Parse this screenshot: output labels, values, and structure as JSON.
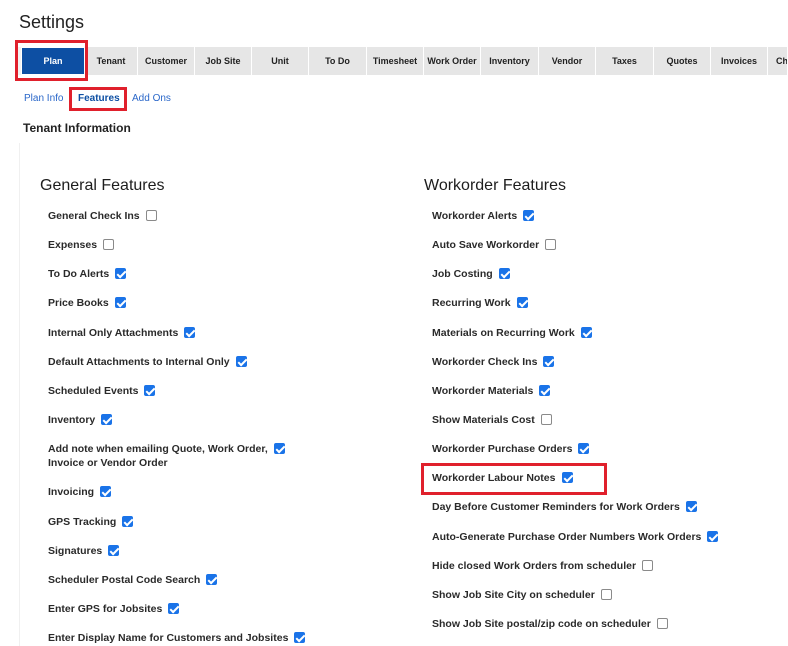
{
  "page": {
    "title": "Settings"
  },
  "tabs": [
    "Plan",
    "Tenant",
    "Customer",
    "Job Site",
    "Unit",
    "To Do",
    "Timesheet",
    "Work Order",
    "Inventory",
    "Vendor",
    "Taxes",
    "Quotes",
    "Invoices",
    "Ch"
  ],
  "active_tab": "Plan",
  "sublinks": [
    "Plan Info",
    "Features",
    "Add Ons"
  ],
  "active_sublink": "Features",
  "section_title": "Tenant Information",
  "general": {
    "title": "General Features",
    "items": [
      {
        "label": "General Check Ins",
        "checked": false
      },
      {
        "label": "Expenses",
        "checked": false
      },
      {
        "label": "To Do Alerts",
        "checked": true
      },
      {
        "label": "Price Books",
        "checked": true
      },
      {
        "label": "Internal Only Attachments",
        "checked": true
      },
      {
        "label": "Default Attachments to Internal Only",
        "checked": true
      },
      {
        "label": "Scheduled Events",
        "checked": true
      },
      {
        "label": "Inventory",
        "checked": true
      },
      {
        "label": "Add note when emailing Quote, Work Order,",
        "label2": "Invoice or Vendor Order",
        "checked": true
      },
      {
        "label": "Invoicing",
        "checked": true
      },
      {
        "label": "GPS Tracking",
        "checked": true
      },
      {
        "label": "Signatures",
        "checked": true
      },
      {
        "label": "Scheduler Postal Code Search",
        "checked": true
      },
      {
        "label": "Enter GPS for Jobsites",
        "checked": true
      },
      {
        "label": "Enter Display Name for Customers and Jobsites",
        "checked": true
      }
    ]
  },
  "workorder": {
    "title": "Workorder Features",
    "items": [
      {
        "label": "Workorder Alerts",
        "checked": true
      },
      {
        "label": "Auto Save Workorder",
        "checked": false
      },
      {
        "label": "Job Costing",
        "checked": true
      },
      {
        "label": "Recurring Work",
        "checked": true
      },
      {
        "label": "Materials on Recurring Work",
        "checked": true
      },
      {
        "label": "Workorder Check Ins",
        "checked": true
      },
      {
        "label": "Workorder Materials",
        "checked": true
      },
      {
        "label": "Show Materials Cost",
        "checked": false
      },
      {
        "label": "Workorder Purchase Orders",
        "checked": true
      },
      {
        "label": "Workorder Labour Notes",
        "checked": true
      },
      {
        "label": "Day Before Customer Reminders for Work Orders",
        "checked": true
      },
      {
        "label": "Auto-Generate Purchase Order Numbers Work Orders",
        "checked": true
      },
      {
        "label": "Hide closed Work Orders from scheduler",
        "checked": false
      },
      {
        "label": "Show Job Site City on scheduler",
        "checked": false
      },
      {
        "label": "Show Job Site postal/zip code on scheduler",
        "checked": false
      }
    ]
  }
}
